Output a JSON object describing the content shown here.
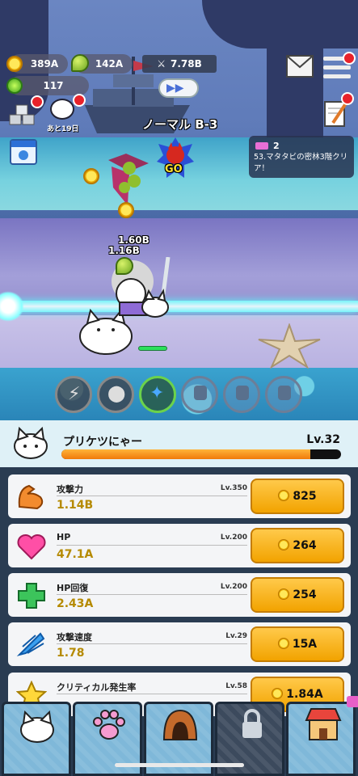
{
  "hud": {
    "coins": "389A",
    "mangoes": "142A",
    "gems": "117",
    "power": "7.78B",
    "days_left": "あと19日"
  },
  "stage": {
    "label": "ノーマル B-3",
    "go": "GO"
  },
  "mission": {
    "count": "2",
    "text": "53.マタタビの密林3階クリア！"
  },
  "damage": {
    "a": "1.60B",
    "b": "1.16B"
  },
  "character": {
    "name": "プリケツにゃー",
    "level": "Lv.32",
    "xp_fraction": 0.89
  },
  "upgrades": [
    {
      "name": "攻撃力",
      "level": "Lv.350",
      "value": "1.14B",
      "cost": "825",
      "icon": "muscle-arm-icon"
    },
    {
      "name": "HP",
      "level": "Lv.200",
      "value": "47.1A",
      "cost": "264",
      "icon": "heart-icon"
    },
    {
      "name": "HP回復",
      "level": "Lv.200",
      "value": "2.43A",
      "cost": "254",
      "icon": "green-cross-icon"
    },
    {
      "name": "攻撃速度",
      "level": "Lv.29",
      "value": "1.78",
      "cost": "15A",
      "icon": "blue-wing-icon"
    },
    {
      "name": "クリティカル発生率",
      "level": "Lv.58",
      "value": "",
      "cost": "1.84A",
      "icon": "star-icon"
    }
  ],
  "colors": {
    "accent_orange": "#f2a300",
    "value_gold": "#b58a00",
    "panel_bg": "#2a3c52"
  }
}
